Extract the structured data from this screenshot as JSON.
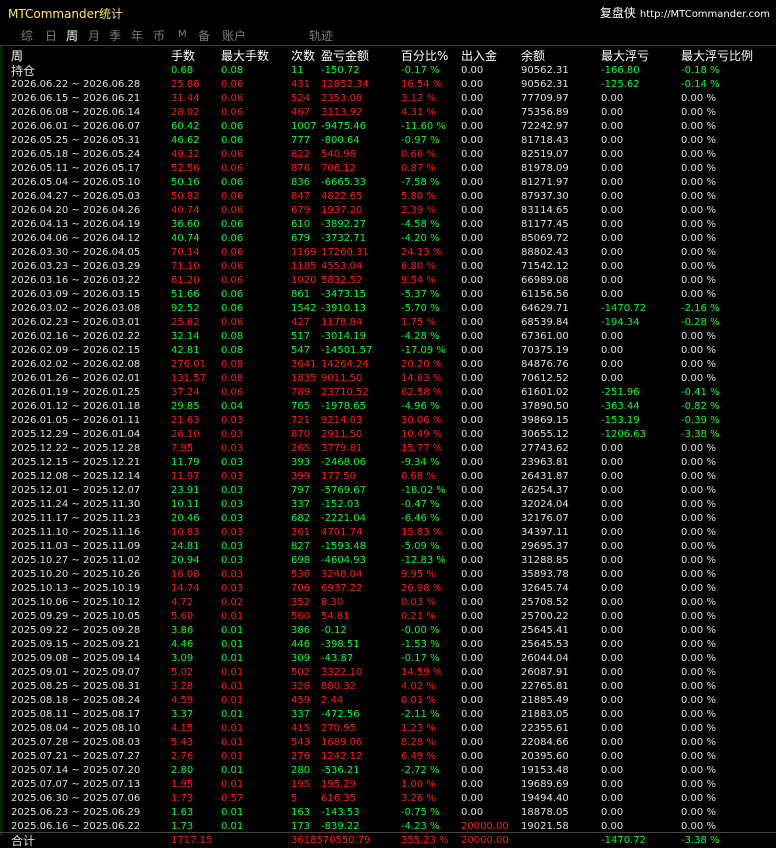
{
  "app": {
    "title": "MTCommander统计",
    "brand": "复盘侠",
    "url": "http://MTCommander.com"
  },
  "tabs": [
    "综",
    "日",
    "周",
    "月",
    "季",
    "年",
    "币",
    "M",
    "备",
    "账户",
    "轨迹"
  ],
  "active_tab": "周",
  "columns": [
    "周",
    "手数",
    "最大手数",
    "次数",
    "盈亏金额",
    "百分比%",
    "出入金",
    "余额",
    "最大浮亏",
    "最大浮亏比例"
  ],
  "colors": {
    "profit": "#ff1a1a",
    "loss": "#00ff2a",
    "neutral": "#e0e0e0",
    "title": "#ffe45a"
  },
  "open_row": {
    "label": "持仓",
    "lots": "0.68",
    "max_lots": "0.08",
    "count": "11",
    "pnl": "-150.72",
    "pct": "-0.17 %",
    "flow": "0.00",
    "balance": "90562.31",
    "max_float": "-166.80",
    "max_float_pct": "-0.18 %"
  },
  "rows": [
    [
      "2026.06.22 ~ 2026.06.28",
      "25.88",
      "0.06",
      "431",
      "12852.34",
      "16.54 %",
      "0.00",
      "90562.31",
      "-125.62",
      "-0.14 %"
    ],
    [
      "2026.06.15 ~ 2026.06.21",
      "31.44",
      "0.06",
      "524",
      "2353.08",
      "3.12 %",
      "0.00",
      "77709.97",
      "0.00",
      "0.00 %"
    ],
    [
      "2026.06.08 ~ 2026.06.14",
      "28.02",
      "0.06",
      "467",
      "3113.92",
      "4.31 %",
      "0.00",
      "75356.89",
      "0.00",
      "0.00 %"
    ],
    [
      "2026.06.01 ~ 2026.06.07",
      "60.42",
      "0.06",
      "1007",
      "-9475.46",
      "-11.60 %",
      "0.00",
      "72242.97",
      "0.00",
      "0.00 %"
    ],
    [
      "2026.05.25 ~ 2026.05.31",
      "46.62",
      "0.06",
      "777",
      "-800.64",
      "-0.97 %",
      "0.00",
      "81718.43",
      "0.00",
      "0.00 %"
    ],
    [
      "2026.05.18 ~ 2026.05.24",
      "49.32",
      "0.06",
      "822",
      "540.98",
      "0.66 %",
      "0.00",
      "82519.07",
      "0.00",
      "0.00 %"
    ],
    [
      "2026.05.11 ~ 2026.05.17",
      "52.56",
      "0.06",
      "876",
      "706.12",
      "0.87 %",
      "0.00",
      "81978.09",
      "0.00",
      "0.00 %"
    ],
    [
      "2026.05.04 ~ 2026.05.10",
      "50.16",
      "0.06",
      "836",
      "-6665.33",
      "-7.58 %",
      "0.00",
      "81271.97",
      "0.00",
      "0.00 %"
    ],
    [
      "2026.04.27 ~ 2026.05.03",
      "50.82",
      "0.06",
      "847",
      "4822.65",
      "5.80 %",
      "0.00",
      "87937.30",
      "0.00",
      "0.00 %"
    ],
    [
      "2026.04.20 ~ 2026.04.26",
      "40.74",
      "0.06",
      "679",
      "1937.20",
      "2.39 %",
      "0.00",
      "83114.65",
      "0.00",
      "0.00 %"
    ],
    [
      "2026.04.13 ~ 2026.04.19",
      "36.60",
      "0.06",
      "610",
      "-3892.27",
      "-4.58 %",
      "0.00",
      "81177.45",
      "0.00",
      "0.00 %"
    ],
    [
      "2026.04.06 ~ 2026.04.12",
      "40.74",
      "0.06",
      "679",
      "-3732.71",
      "-4.20 %",
      "0.00",
      "85069.72",
      "0.00",
      "0.00 %"
    ],
    [
      "2026.03.30 ~ 2026.04.05",
      "70.14",
      "0.06",
      "1169",
      "17260.31",
      "24.13 %",
      "0.00",
      "88802.43",
      "0.00",
      "0.00 %"
    ],
    [
      "2026.03.23 ~ 2026.03.29",
      "71.10",
      "0.06",
      "1185",
      "4553.04",
      "6.80 %",
      "0.00",
      "71542.12",
      "0.00",
      "0.00 %"
    ],
    [
      "2026.03.16 ~ 2026.03.22",
      "61.20",
      "0.06",
      "1020",
      "5832.52",
      "9.54 %",
      "0.00",
      "66989.08",
      "0.00",
      "0.00 %"
    ],
    [
      "2026.03.09 ~ 2026.03.15",
      "51.66",
      "0.06",
      "861",
      "-3473.15",
      "-5.37 %",
      "0.00",
      "61156.56",
      "0.00",
      "0.00 %"
    ],
    [
      "2026.03.02 ~ 2026.03.08",
      "92.52",
      "0.06",
      "1542",
      "-3910.13",
      "-5.70 %",
      "0.00",
      "64629.71",
      "-1470.72",
      "-2.16 %"
    ],
    [
      "2026.02.23 ~ 2026.03.01",
      "25.62",
      "0.06",
      "427",
      "1178.84",
      "1.75 %",
      "0.00",
      "68539.84",
      "-194.34",
      "-0.28 %"
    ],
    [
      "2026.02.16 ~ 2026.02.22",
      "32.14",
      "0.08",
      "517",
      "-3014.19",
      "-4.28 %",
      "0.00",
      "67361.00",
      "0.00",
      "0.00 %"
    ],
    [
      "2026.02.09 ~ 2026.02.15",
      "42.81",
      "0.08",
      "547",
      "-14501.57",
      "-17.09 %",
      "0.00",
      "70375.19",
      "0.00",
      "0.00 %"
    ],
    [
      "2026.02.02 ~ 2026.02.08",
      "276.01",
      "0.08",
      "3641",
      "14264.24",
      "20.20 %",
      "0.00",
      "84876.76",
      "0.00",
      "0.00 %"
    ],
    [
      "2026.01.26 ~ 2026.02.01",
      "131.57",
      "0.08",
      "1835",
      "9011.50",
      "14.63 %",
      "0.00",
      "70612.52",
      "0.00",
      "0.00 %"
    ],
    [
      "2026.01.19 ~ 2026.01.25",
      "37.24",
      "0.06",
      "789",
      "23710.52",
      "62.58 %",
      "0.00",
      "61601.02",
      "-251.96",
      "-0.41 %"
    ],
    [
      "2026.01.12 ~ 2026.01.18",
      "29.85",
      "0.04",
      "765",
      "-1978.65",
      "-4.96 %",
      "0.00",
      "37890.50",
      "-363.44",
      "-0.82 %"
    ],
    [
      "2026.01.05 ~ 2026.01.11",
      "21.63",
      "0.03",
      "721",
      "9214.03",
      "30.06 %",
      "0.00",
      "39869.15",
      "-153.19",
      "-0.39 %"
    ],
    [
      "2025.12.29 ~ 2026.01.04",
      "26.10",
      "0.03",
      "870",
      "2911.50",
      "10.49 %",
      "0.00",
      "30655.12",
      "-1206.63",
      "-3.38 %"
    ],
    [
      "2025.12.22 ~ 2025.12.28",
      "7.95",
      "0.03",
      "265",
      "3779.81",
      "15.77 %",
      "0.00",
      "27743.62",
      "0.00",
      "0.00 %"
    ],
    [
      "2025.12.15 ~ 2025.12.21",
      "11.79",
      "0.03",
      "393",
      "-2468.06",
      "-9.34 %",
      "0.00",
      "23963.81",
      "0.00",
      "0.00 %"
    ],
    [
      "2025.12.08 ~ 2025.12.14",
      "11.97",
      "0.03",
      "399",
      "177.50",
      "0.68 %",
      "0.00",
      "26431.87",
      "0.00",
      "0.00 %"
    ],
    [
      "2025.12.01 ~ 2025.12.07",
      "23.91",
      "0.03",
      "797",
      "-5769.67",
      "-18.02 %",
      "0.00",
      "26254.37",
      "0.00",
      "0.00 %"
    ],
    [
      "2025.11.24 ~ 2025.11.30",
      "10.11",
      "0.03",
      "337",
      "-152.03",
      "-0.47 %",
      "0.00",
      "32024.04",
      "0.00",
      "0.00 %"
    ],
    [
      "2025.11.17 ~ 2025.11.23",
      "20.46",
      "0.03",
      "682",
      "-2221.04",
      "-6.46 %",
      "0.00",
      "32176.07",
      "0.00",
      "0.00 %"
    ],
    [
      "2025.11.10 ~ 2025.11.16",
      "10.83",
      "0.03",
      "361",
      "4701.74",
      "15.83 %",
      "0.00",
      "34397.11",
      "0.00",
      "0.00 %"
    ],
    [
      "2025.11.03 ~ 2025.11.09",
      "24.81",
      "0.03",
      "827",
      "-1593.48",
      "-5.09 %",
      "0.00",
      "29695.37",
      "0.00",
      "0.00 %"
    ],
    [
      "2025.10.27 ~ 2025.11.02",
      "20.94",
      "0.03",
      "698",
      "-4604.93",
      "-12.83 %",
      "0.00",
      "31288.85",
      "0.00",
      "0.00 %"
    ],
    [
      "2025.10.20 ~ 2025.10.26",
      "16.08",
      "0.03",
      "536",
      "3248.04",
      "9.95 %",
      "0.00",
      "35893.78",
      "0.00",
      "0.00 %"
    ],
    [
      "2025.10.13 ~ 2025.10.19",
      "14.74",
      "0.03",
      "706",
      "6937.22",
      "26.98 %",
      "0.00",
      "32645.74",
      "0.00",
      "0.00 %"
    ],
    [
      "2025.10.06 ~ 2025.10.12",
      "4.72",
      "0.02",
      "352",
      "8.30",
      "0.03 %",
      "0.00",
      "25708.52",
      "0.00",
      "0.00 %"
    ],
    [
      "2025.09.29 ~ 2025.10.05",
      "5.60",
      "0.01",
      "560",
      "54.81",
      "0.21 %",
      "0.00",
      "25700.22",
      "0.00",
      "0.00 %"
    ],
    [
      "2025.09.22 ~ 2025.09.28",
      "3.86",
      "0.01",
      "386",
      "-0.12",
      "-0.00 %",
      "0.00",
      "25645.41",
      "0.00",
      "0.00 %"
    ],
    [
      "2025.09.15 ~ 2025.09.21",
      "4.46",
      "0.01",
      "446",
      "-398.51",
      "-1.53 %",
      "0.00",
      "25645.53",
      "0.00",
      "0.00 %"
    ],
    [
      "2025.09.08 ~ 2025.09.14",
      "3.09",
      "0.01",
      "309",
      "-43.87",
      "-0.17 %",
      "0.00",
      "26044.04",
      "0.00",
      "0.00 %"
    ],
    [
      "2025.09.01 ~ 2025.09.07",
      "5.02",
      "0.01",
      "502",
      "3322.10",
      "14.59 %",
      "0.00",
      "26087.91",
      "0.00",
      "0.00 %"
    ],
    [
      "2025.08.25 ~ 2025.08.31",
      "3.28",
      "0.01",
      "328",
      "880.32",
      "4.02 %",
      "0.00",
      "22765.81",
      "0.00",
      "0.00 %"
    ],
    [
      "2025.08.18 ~ 2025.08.24",
      "4.59",
      "0.01",
      "459",
      "2.44",
      "0.01 %",
      "0.00",
      "21885.49",
      "0.00",
      "0.00 %"
    ],
    [
      "2025.08.11 ~ 2025.08.17",
      "3.37",
      "0.01",
      "337",
      "-472.56",
      "-2.11 %",
      "0.00",
      "21883.05",
      "0.00",
      "0.00 %"
    ],
    [
      "2025.08.04 ~ 2025.08.10",
      "4.15",
      "0.01",
      "415",
      "270.95",
      "1.23 %",
      "0.00",
      "22355.61",
      "0.00",
      "0.00 %"
    ],
    [
      "2025.07.28 ~ 2025.08.03",
      "5.43",
      "0.01",
      "543",
      "1689.06",
      "8.28 %",
      "0.00",
      "22084.66",
      "0.00",
      "0.00 %"
    ],
    [
      "2025.07.21 ~ 2025.07.27",
      "2.76",
      "0.01",
      "276",
      "1242.12",
      "6.49 %",
      "0.00",
      "20395.60",
      "0.00",
      "0.00 %"
    ],
    [
      "2025.07.14 ~ 2025.07.20",
      "2.80",
      "0.01",
      "280",
      "-536.21",
      "-2.72 %",
      "0.00",
      "19153.48",
      "0.00",
      "0.00 %"
    ],
    [
      "2025.07.07 ~ 2025.07.13",
      "1.95",
      "0.01",
      "195",
      "195.29",
      "1.00 %",
      "0.00",
      "19689.69",
      "0.00",
      "0.00 %"
    ],
    [
      "2025.06.30 ~ 2025.07.06",
      "1.73",
      "0.57",
      "5",
      "616.35",
      "3.26 %",
      "0.00",
      "19494.40",
      "0.00",
      "0.00 %"
    ],
    [
      "2025.06.23 ~ 2025.06.29",
      "1.63",
      "0.01",
      "163",
      "-143.53",
      "-0.75 %",
      "0.00",
      "18878.05",
      "0.00",
      "0.00 %"
    ],
    [
      "2025.06.16 ~ 2025.06.22",
      "1.73",
      "0.01",
      "173",
      "-839.22",
      "-4.23 %",
      "20000.00",
      "19021.58",
      "0.00",
      "0.00 %"
    ]
  ],
  "total": {
    "label": "合计",
    "lots": "1717.15",
    "count_pnl": "3618570550.79",
    "pct": "355.23 %",
    "flow": "20000.00",
    "max_float": "-1470.72",
    "max_float_pct": "-3.38 %"
  }
}
